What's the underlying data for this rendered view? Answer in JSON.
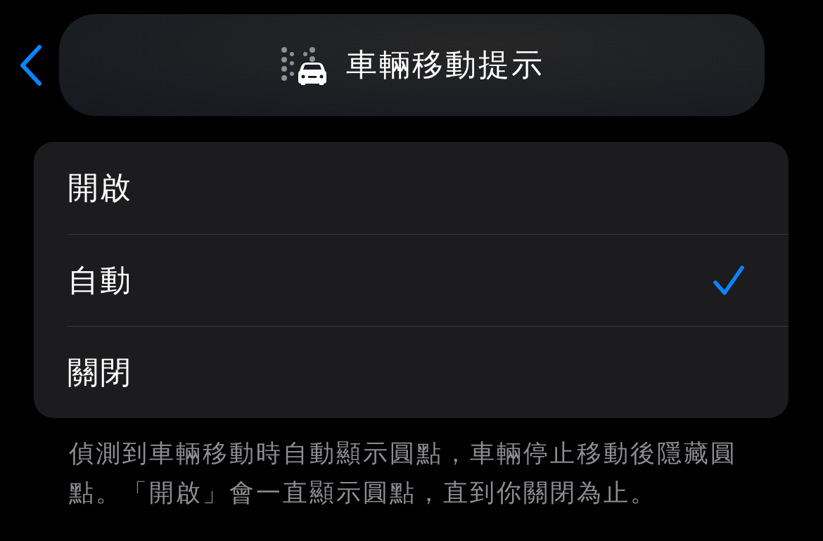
{
  "header": {
    "title": "車輛移動提示"
  },
  "options": [
    {
      "label": "開啟",
      "selected": false
    },
    {
      "label": "自動",
      "selected": true
    },
    {
      "label": "關閉",
      "selected": false
    }
  ],
  "footer": "偵測到車輛移動時自動顯示圓點，車輛停止移動後隱藏圓點。「開啟」會一直顯示圓點，直到你關閉為止。"
}
